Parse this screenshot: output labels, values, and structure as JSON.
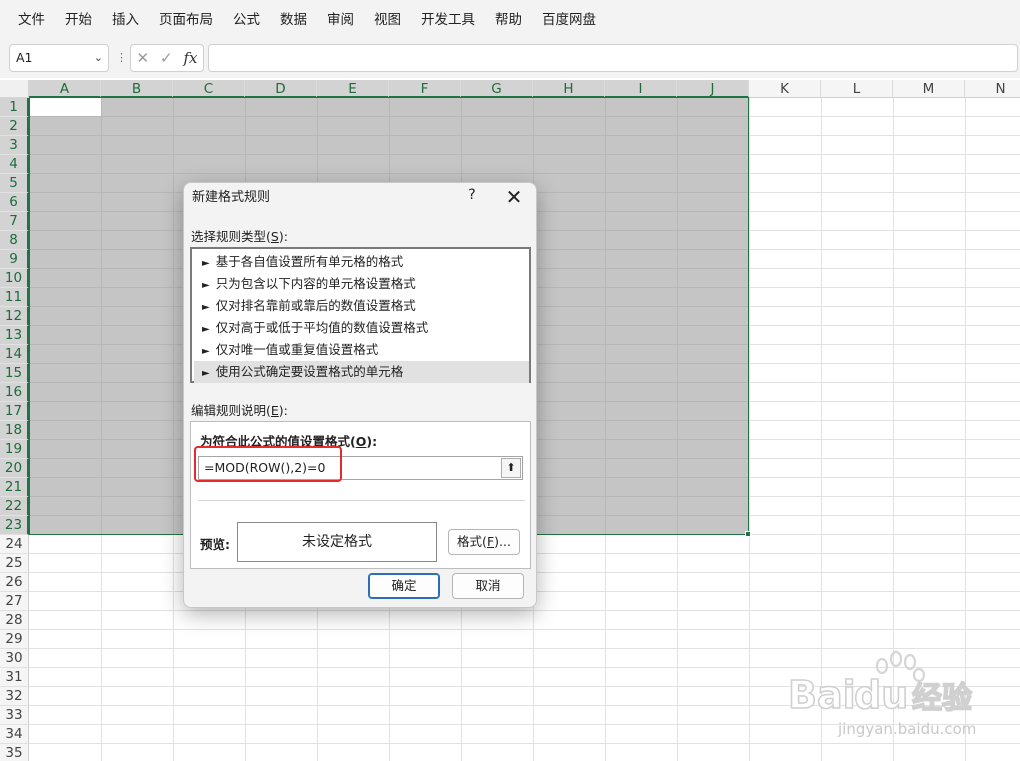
{
  "menu": [
    "文件",
    "开始",
    "插入",
    "页面布局",
    "公式",
    "数据",
    "审阅",
    "视图",
    "开发工具",
    "帮助",
    "百度网盘"
  ],
  "formula_bar": {
    "name_box": "A1",
    "cancel_icon": "✕",
    "enter_icon": "✓",
    "fx_label": "fx",
    "value": ""
  },
  "grid": {
    "columns": [
      "A",
      "B",
      "C",
      "D",
      "E",
      "F",
      "G",
      "H",
      "I",
      "J",
      "K",
      "L",
      "M",
      "N"
    ],
    "selected_columns": [
      "A",
      "B",
      "C",
      "D",
      "E",
      "F",
      "G",
      "H",
      "I",
      "J"
    ],
    "rows": [
      "1",
      "2",
      "3",
      "4",
      "5",
      "6",
      "7",
      "8",
      "9",
      "10",
      "11",
      "12",
      "13",
      "14",
      "15",
      "16",
      "17",
      "18",
      "19",
      "20",
      "21",
      "22",
      "23",
      "24",
      "25",
      "26",
      "27",
      "28",
      "29",
      "30",
      "31",
      "32",
      "33",
      "34",
      "35"
    ],
    "selected_row_count": 23,
    "selection_range": "A1:J23",
    "accent_color": "#217346"
  },
  "dialog": {
    "title": "新建格式规则",
    "help": "?",
    "close": "✕",
    "rule_type_label": "选择规则类型(",
    "rule_type_key": "S",
    "rule_type_suffix": "):",
    "rule_types": [
      "基于各自值设置所有单元格的格式",
      "只为包含以下内容的单元格设置格式",
      "仅对排名靠前或靠后的数值设置格式",
      "仅对高于或低于平均值的数值设置格式",
      "仅对唯一值或重复值设置格式",
      "使用公式确定要设置格式的单元格"
    ],
    "selected_rule_index": 5,
    "edit_label": "编辑规则说明(",
    "edit_key": "E",
    "edit_suffix": "):",
    "formula_label": "为符合此公式的值设置格式(",
    "formula_key": "O",
    "formula_suffix": "):",
    "formula": "=MOD(ROW(),2)=0",
    "collapse_icon": "⬆",
    "preview_label": "预览:",
    "preview_text": "未设定格式",
    "format_button_text": "格式(",
    "format_button_key": "F",
    "format_button_suffix": ")...",
    "ok": "确定",
    "cancel": "取消",
    "highlight_color": "#e52b2b"
  },
  "watermark": {
    "brand_a": "Bai",
    "brand_b": "du",
    "brand_cn": "经验",
    "url": "jingyan.baidu.com"
  }
}
